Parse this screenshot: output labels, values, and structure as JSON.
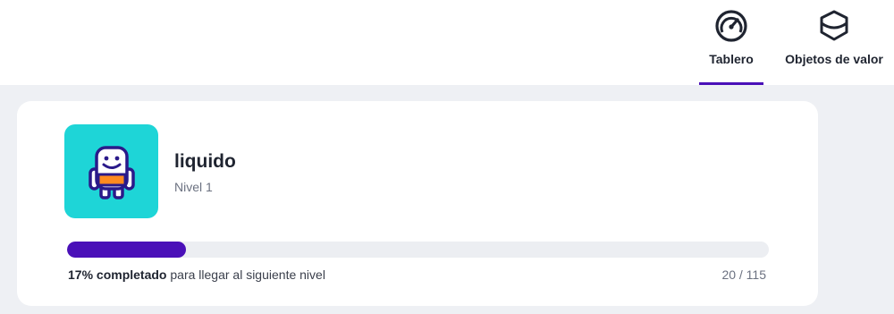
{
  "nav": {
    "tabs": [
      {
        "label": "Tablero",
        "icon": "speedometer-icon",
        "active": true
      },
      {
        "label": "Objetos de valor",
        "icon": "gem-icon",
        "active": false
      }
    ]
  },
  "profile": {
    "username": "liquido",
    "level": "Nivel 1",
    "avatar_icon": "robot-avatar-icon",
    "avatar_color": "#1ed5d7"
  },
  "progress": {
    "percent": 17,
    "percent_text": "17% completado",
    "rest_text": " para llegar al siguiente nivel",
    "count_text": "20 / 115",
    "bar_color": "#4a10b8"
  },
  "colors": {
    "accent": "#4a10b8",
    "background": "#eef0f4"
  }
}
